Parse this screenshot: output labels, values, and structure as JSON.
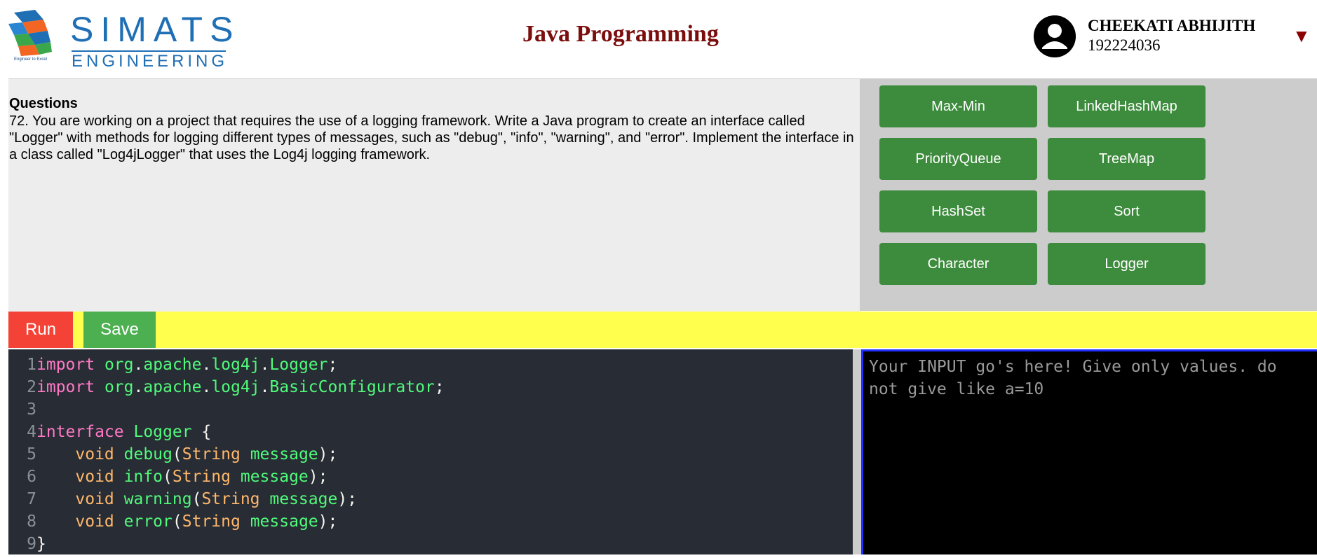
{
  "header": {
    "logo_main": "SIMATS",
    "logo_sub": "ENGINEERING",
    "logo_tagline": "Engineer to Excel",
    "title": "Java Programming",
    "user_name": "CHEEKATI ABHIJITH",
    "user_id": "192224036",
    "dropdown_icon": "caret-down-icon",
    "colors": {
      "title": "#7b0d0d",
      "logo": "#1f6fb5"
    }
  },
  "question": {
    "heading": "Questions",
    "text": "72. You are working on a project that requires the use of a logging framework. Write a Java program to create an interface called \"Logger\" with methods for logging different types of messages, such as \"debug\", \"info\", \"warning\", and \"error\". Implement the interface in a class called \"Log4jLogger\" that uses the Log4j logging framework."
  },
  "topics": [
    {
      "label": "Max-Min"
    },
    {
      "label": "LinkedHashMap"
    },
    {
      "label": "PriorityQueue"
    },
    {
      "label": "TreeMap"
    },
    {
      "label": "HashSet"
    },
    {
      "label": "Sort"
    },
    {
      "label": "Character"
    },
    {
      "label": "Logger"
    }
  ],
  "toolbar": {
    "run_label": "Run",
    "save_label": "Save",
    "colors": {
      "bar": "#ffff4d",
      "run": "#f44336",
      "save": "#4caf50"
    }
  },
  "editor": {
    "lines": [
      {
        "n": "1",
        "tokens": [
          [
            "k",
            "import"
          ],
          [
            "p",
            " "
          ],
          [
            "g",
            "org"
          ],
          [
            "p",
            "."
          ],
          [
            "g",
            "apache"
          ],
          [
            "p",
            "."
          ],
          [
            "g",
            "log4j"
          ],
          [
            "p",
            "."
          ],
          [
            "g",
            "Logger"
          ],
          [
            "p",
            ";"
          ]
        ]
      },
      {
        "n": "2",
        "tokens": [
          [
            "k",
            "import"
          ],
          [
            "p",
            " "
          ],
          [
            "g",
            "org"
          ],
          [
            "p",
            "."
          ],
          [
            "g",
            "apache"
          ],
          [
            "p",
            "."
          ],
          [
            "g",
            "log4j"
          ],
          [
            "p",
            "."
          ],
          [
            "g",
            "BasicConfigurator"
          ],
          [
            "p",
            ";"
          ]
        ]
      },
      {
        "n": "3",
        "tokens": []
      },
      {
        "n": "4",
        "tokens": [
          [
            "k",
            "interface"
          ],
          [
            "p",
            " "
          ],
          [
            "g",
            "Logger"
          ],
          [
            "p",
            " {"
          ]
        ]
      },
      {
        "n": "5",
        "tokens": [
          [
            "p",
            "    "
          ],
          [
            "t",
            "void"
          ],
          [
            "p",
            " "
          ],
          [
            "g",
            "debug"
          ],
          [
            "p",
            "("
          ],
          [
            "t",
            "String"
          ],
          [
            "p",
            " "
          ],
          [
            "g",
            "message"
          ],
          [
            "p",
            ");"
          ]
        ]
      },
      {
        "n": "6",
        "tokens": [
          [
            "p",
            "    "
          ],
          [
            "t",
            "void"
          ],
          [
            "p",
            " "
          ],
          [
            "g",
            "info"
          ],
          [
            "p",
            "("
          ],
          [
            "t",
            "String"
          ],
          [
            "p",
            " "
          ],
          [
            "g",
            "message"
          ],
          [
            "p",
            ");"
          ]
        ]
      },
      {
        "n": "7",
        "tokens": [
          [
            "p",
            "    "
          ],
          [
            "t",
            "void"
          ],
          [
            "p",
            " "
          ],
          [
            "g",
            "warning"
          ],
          [
            "p",
            "("
          ],
          [
            "t",
            "String"
          ],
          [
            "p",
            " "
          ],
          [
            "g",
            "message"
          ],
          [
            "p",
            ");"
          ]
        ]
      },
      {
        "n": "8",
        "tokens": [
          [
            "p",
            "    "
          ],
          [
            "t",
            "void"
          ],
          [
            "p",
            " "
          ],
          [
            "g",
            "error"
          ],
          [
            "p",
            "("
          ],
          [
            "t",
            "String"
          ],
          [
            "p",
            " "
          ],
          [
            "g",
            "message"
          ],
          [
            "p",
            ");"
          ]
        ]
      },
      {
        "n": "9",
        "tokens": [
          [
            "p",
            "}"
          ]
        ]
      }
    ]
  },
  "input": {
    "placeholder": "Your INPUT go's here! Give only values. do not give like a=10",
    "value": ""
  }
}
